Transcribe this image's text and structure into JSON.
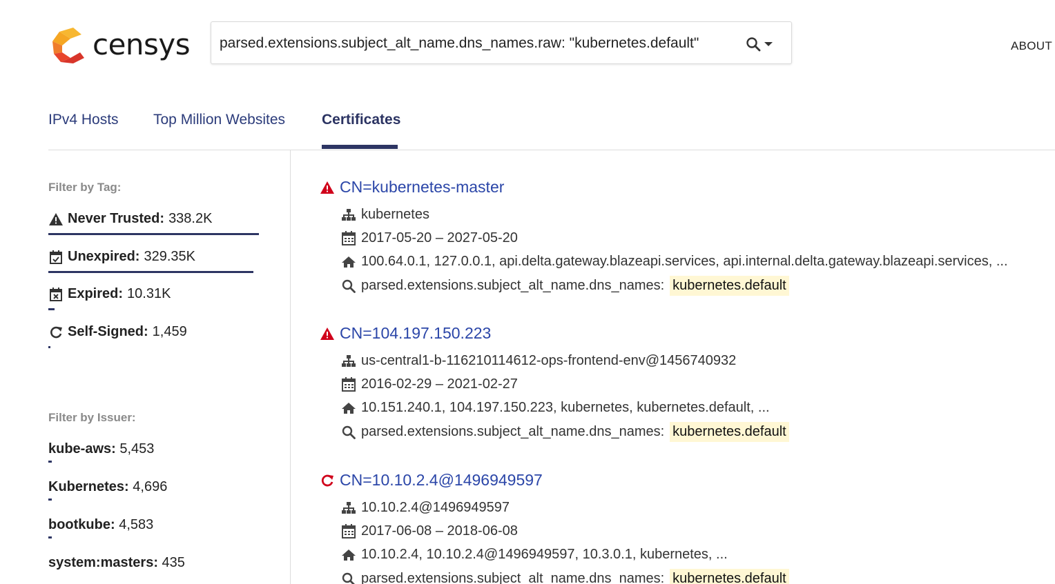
{
  "header": {
    "logo_text": "censys",
    "search": {
      "value": "parsed.extensions.subject_alt_name.dns_names.raw: \"kubernetes.default\"",
      "placeholder": ""
    },
    "about_label": "ABOUT"
  },
  "tabs": [
    {
      "label": "IPv4 Hosts",
      "active": false
    },
    {
      "label": "Top Million Websites",
      "active": false
    },
    {
      "label": "Certificates",
      "active": true
    }
  ],
  "sidebar": {
    "tag_heading": "Filter by Tag:",
    "tags": [
      {
        "icon": "warning-icon",
        "label": "Never Trusted:",
        "count": "338.2K",
        "share": 1.0
      },
      {
        "icon": "calendar-check-icon",
        "label": "Unexpired:",
        "count": "329.35K",
        "share": 0.9738
      },
      {
        "icon": "calendar-x-icon",
        "label": "Expired:",
        "count": "10.31K",
        "share": 0.0305
      },
      {
        "icon": "refresh-icon",
        "label": "Self-Signed:",
        "count": "1,459",
        "share": 0.0043
      }
    ],
    "issuer_heading": "Filter by Issuer:",
    "issuers": [
      {
        "label": "kube-aws:",
        "count": "5,453"
      },
      {
        "label": "Kubernetes:",
        "count": "4,696"
      },
      {
        "label": "bootkube:",
        "count": "4,583"
      },
      {
        "label": "system:masters:",
        "count": "435"
      }
    ]
  },
  "results": [
    {
      "status_icon": "warning-icon",
      "title": "CN=kubernetes-master",
      "org": "kubernetes",
      "validity": "2017-05-20 – 2027-05-20",
      "names": "100.64.0.1, 127.0.0.1, api.delta.gateway.blazeapi.services, api.internal.delta.gateway.blazeapi.services, ...",
      "match_field": "parsed.extensions.subject_alt_name.dns_names:",
      "match_value": "kubernetes.default"
    },
    {
      "status_icon": "warning-icon",
      "title": "CN=104.197.150.223",
      "org": "us-central1-b-116210114612-ops-frontend-env@1456740932",
      "validity": "2016-02-29 – 2021-02-27",
      "names": "10.151.240.1, 104.197.150.223, kubernetes, kubernetes.default, ...",
      "match_field": "parsed.extensions.subject_alt_name.dns_names:",
      "match_value": "kubernetes.default"
    },
    {
      "status_icon": "refresh-icon",
      "title": "CN=10.10.2.4@1496949597",
      "org": "10.10.2.4@1496949597",
      "validity": "2017-06-08 – 2018-06-08",
      "names": "10.10.2.4, 10.10.2.4@1496949597, 10.3.0.1, kubernetes, ...",
      "match_field": "parsed.extensions.subject_alt_name.dns_names:",
      "match_value": "kubernetes.default"
    }
  ],
  "colors": {
    "brand_orange": "#f5a623",
    "brand_red": "#e8452c",
    "link_blue": "#2b46a8",
    "nav_dark": "#2d3563",
    "alert_red": "#d0021b",
    "highlight": "#fff7d4"
  }
}
